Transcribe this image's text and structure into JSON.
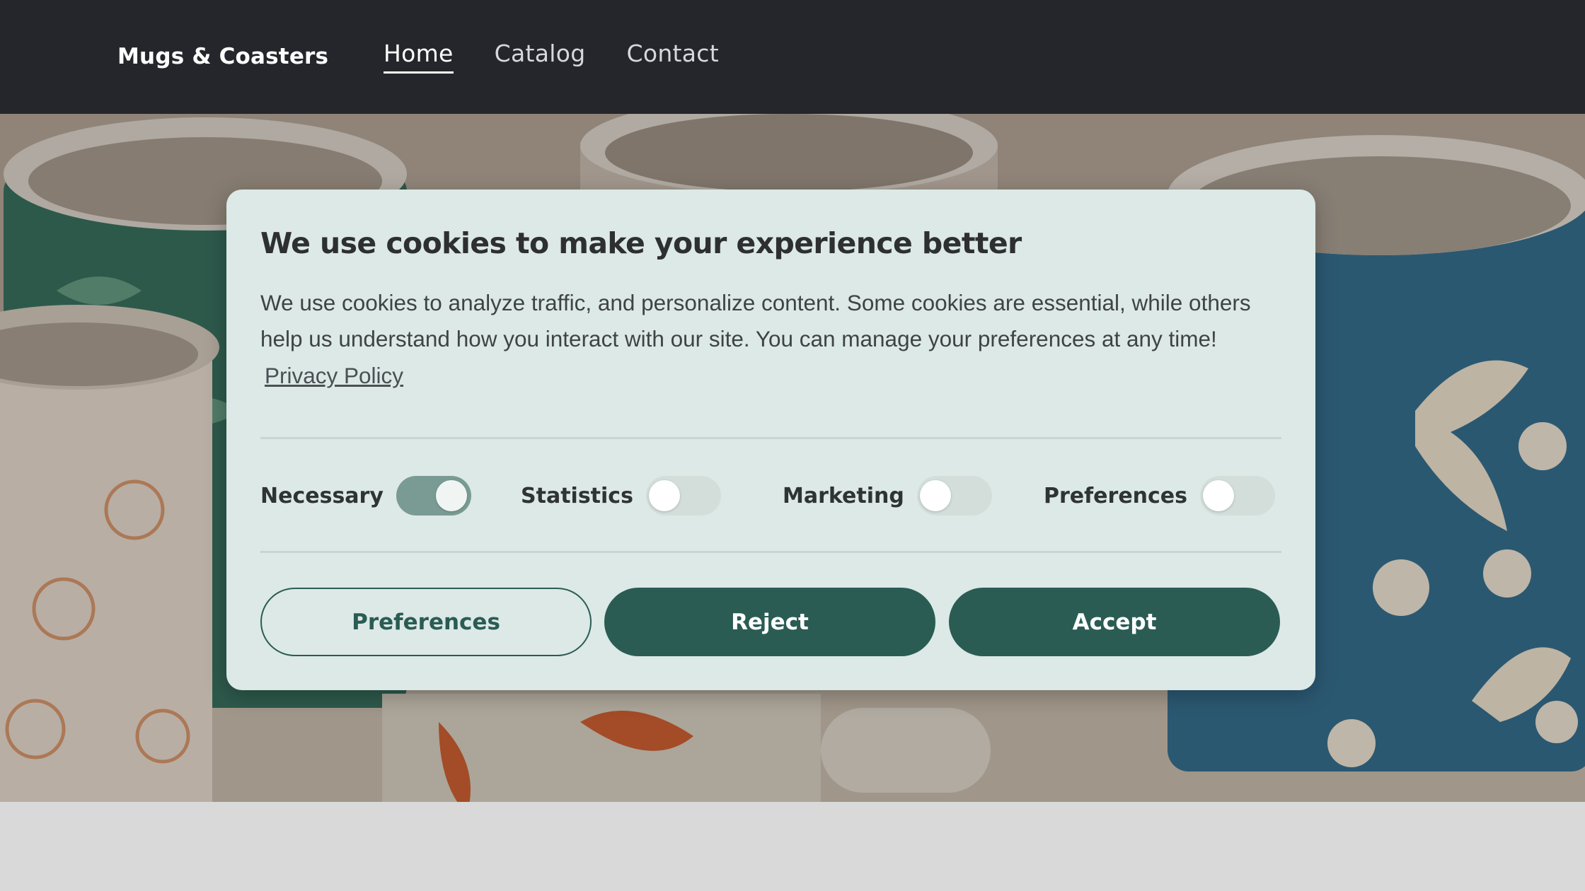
{
  "header": {
    "brand": "Mugs & Coasters",
    "nav": [
      {
        "label": "Home",
        "active": true
      },
      {
        "label": "Catalog",
        "active": false
      },
      {
        "label": "Contact",
        "active": false
      }
    ]
  },
  "hero": {
    "image": "mugs-with-floral-koi-and-crane-patterns"
  },
  "cookie_modal": {
    "title": "We use cookies to make your experience better",
    "body": "We use cookies to analyze traffic, and personalize content. Some cookies are essential, while others help us understand how you interact with our site. You can manage your preferences at any time!",
    "privacy_link": "Privacy Policy",
    "toggles": [
      {
        "label": "Necessary",
        "on": true
      },
      {
        "label": "Statistics",
        "on": false
      },
      {
        "label": "Marketing",
        "on": false
      },
      {
        "label": "Preferences",
        "on": false
      }
    ],
    "buttons": {
      "preferences": "Preferences",
      "reject": "Reject",
      "accept": "Accept"
    }
  },
  "colors": {
    "header_bg": "#25262b",
    "modal_bg": "#dce9e6",
    "accent": "#2a5c54",
    "toggle_on": "#7a9b94",
    "toggle_off": "#d3dedb"
  }
}
